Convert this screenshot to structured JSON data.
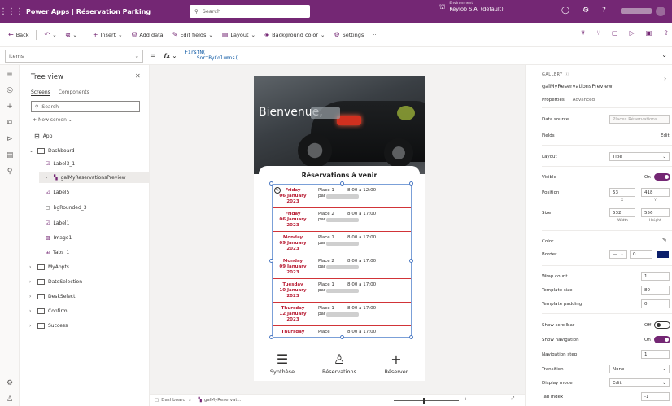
{
  "topbar": {
    "app_title": "Power Apps | Réservation Parking",
    "search_placeholder": "Search",
    "environment_label": "Environment",
    "environment_name": "Keylob S.A. (default)"
  },
  "cmdbar": {
    "back": "Back",
    "insert": "Insert",
    "add_data": "Add data",
    "edit_fields": "Edit fields",
    "layout": "Layout",
    "background_color": "Background color",
    "settings": "Settings"
  },
  "formula": {
    "property": "Items",
    "line1": "FirstN(",
    "line2": "    SortByColumns("
  },
  "tree": {
    "title": "Tree view",
    "tab_screens": "Screens",
    "tab_components": "Components",
    "search_placeholder": "Search",
    "new_screen": "New screen",
    "nodes": [
      "App",
      "Dashboard",
      "Label3_1",
      "galMyReservationsPreview",
      "Label5",
      "bgRounded_3",
      "Label1",
      "Image1",
      "Tabs_1",
      "MyAppts",
      "DateSelection",
      "DeskSelect",
      "Confirm",
      "Success"
    ]
  },
  "phone": {
    "greeting": "Bienvenue,",
    "card_title": "Réservations à venir",
    "par": "par",
    "rows": [
      {
        "day": "Friday",
        "date": "06 January 2023",
        "place": "Place 1",
        "time": "8:00 à 12:00"
      },
      {
        "day": "Friday",
        "date": "06 January 2023",
        "place": "Place 2",
        "time": "8:00 à 17:00"
      },
      {
        "day": "Monday",
        "date": "09 January 2023",
        "place": "Place 1",
        "time": "8:00 à 17:00"
      },
      {
        "day": "Monday",
        "date": "09 January 2023",
        "place": "Place 2",
        "time": "8:00 à 17:00"
      },
      {
        "day": "Tuesday",
        "date": "10 January 2023",
        "place": "Place 1",
        "time": "8:00 à 17:00"
      },
      {
        "day": "Thursday",
        "date": "12 January 2023",
        "place": "Place 1",
        "time": "8:00 à 17:00"
      },
      {
        "day": "Thursday",
        "date": "",
        "place": "Place",
        "time": "8:00 à 17:00"
      }
    ],
    "nav": [
      "Synthèse",
      "Réservations",
      "Réserver"
    ]
  },
  "statusbar": {
    "screen": "Dashboard",
    "control": "galMyReservati..."
  },
  "props": {
    "kind": "GALLERY",
    "name": "galMyReservationsPreview",
    "tab_properties": "Properties",
    "tab_advanced": "Advanced",
    "data_source_label": "Data source",
    "data_source_value": "Places Réservations",
    "fields_label": "Fields",
    "fields_action": "Edit",
    "layout_label": "Layout",
    "layout_value": "Title",
    "visible_label": "Visible",
    "visible_value": "On",
    "position_label": "Position",
    "position_x": "53",
    "position_y": "418",
    "x_sub": "X",
    "y_sub": "Y",
    "size_label": "Size",
    "size_w": "532",
    "size_h": "556",
    "w_sub": "Width",
    "h_sub": "Height",
    "color_label": "Color",
    "border_label": "Border",
    "border_value": "0",
    "wrap_label": "Wrap count",
    "wrap_value": "1",
    "tsize_label": "Template size",
    "tsize_value": "80",
    "tpad_label": "Template padding",
    "tpad_value": "0",
    "scroll_label": "Show scrollbar",
    "scroll_value": "Off",
    "snav_label": "Show navigation",
    "snav_value": "On",
    "navstep_label": "Navigation step",
    "navstep_value": "1",
    "transition_label": "Transition",
    "transition_value": "None",
    "display_label": "Display mode",
    "display_value": "Edit",
    "tab_label": "Tab index",
    "tab_value": "-1"
  },
  "colors": {
    "brand": "#742774",
    "accent_red": "#b81c33",
    "border_swatch": "#0b1f6b"
  }
}
